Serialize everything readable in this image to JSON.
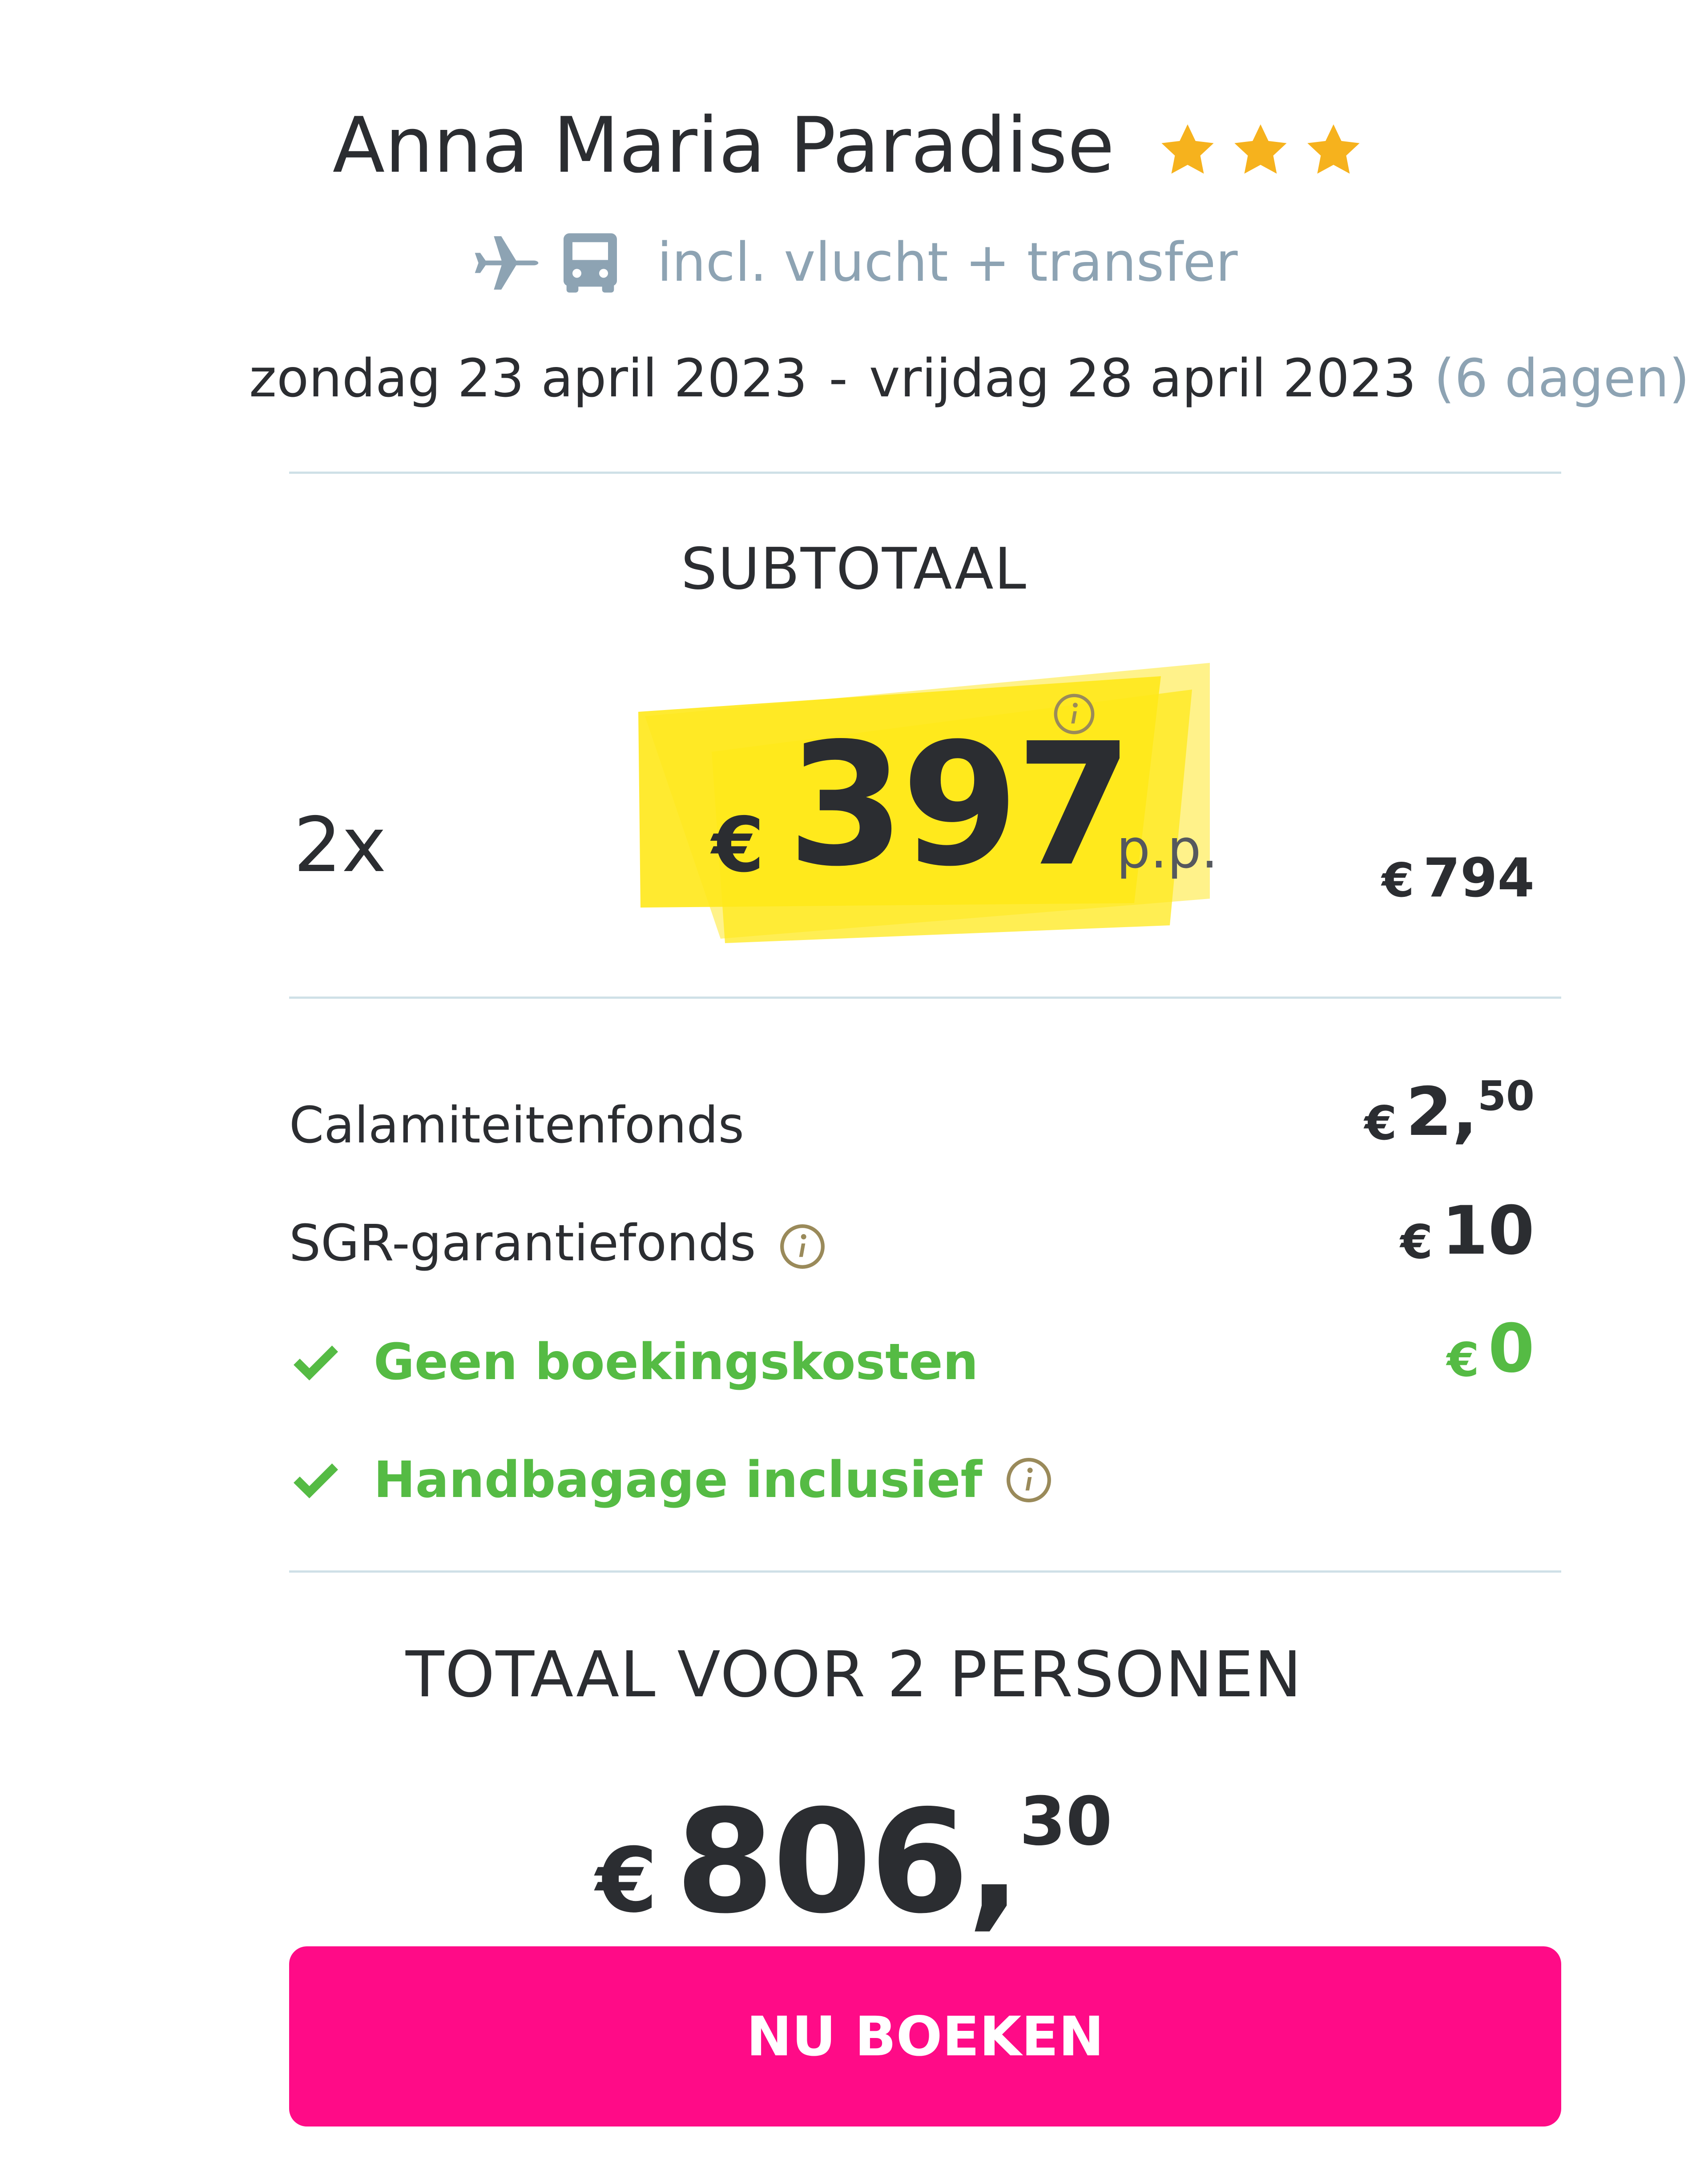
{
  "header": {
    "hotel_name": "Anna Maria Paradise",
    "star_count": 3,
    "star_color": "#f6b21d",
    "transport_icons": [
      "plane-icon",
      "bus-icon"
    ],
    "transport_text": "incl. vlucht + transfer",
    "date_from": "zondag 23 april 2023",
    "date_separator": "-",
    "date_to": "vrijdag 28 april 2023",
    "duration": "(6 dagen)"
  },
  "subtotal": {
    "label": "SUBTOTAAL",
    "multiplier": "2x",
    "currency": "€",
    "price_per_person": "397",
    "per_person_suffix": "p.p.",
    "highlight_color": "#ffe81a",
    "subtotal_currency": "€",
    "subtotal_amount": "794"
  },
  "fees": [
    {
      "label": "Calamiteitenfonds",
      "currency": "€",
      "amount_int": "2,",
      "amount_dec": "50",
      "info": false
    },
    {
      "label": "SGR-garantiefonds",
      "currency": "€",
      "amount_int": "10",
      "amount_dec": "",
      "info": true
    }
  ],
  "perks": [
    {
      "label": "Geen boekingskosten",
      "currency": "€",
      "amount": "0",
      "info": false
    },
    {
      "label": "Handbagage inclusief",
      "info": true
    }
  ],
  "perk_color": "#55bb44",
  "total": {
    "label": "TOTAAL VOOR 2 PERSONEN",
    "currency": "€",
    "amount_int": "806,",
    "amount_dec": "30"
  },
  "cta": {
    "label": "NU BOEKEN",
    "color": "#ff0b87"
  }
}
